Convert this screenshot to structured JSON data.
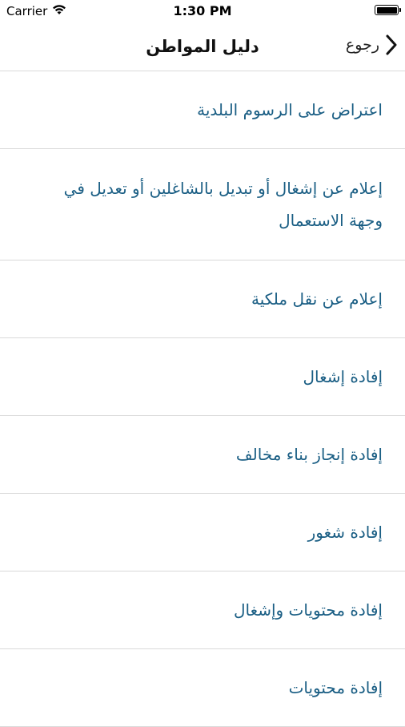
{
  "status": {
    "carrier": "Carrier",
    "time": "1:30 PM"
  },
  "nav": {
    "title": "دليل المواطن",
    "back_label": "رجوع"
  },
  "items": [
    {
      "label": "اعتراض على الرسوم البلدية"
    },
    {
      "label": "إعلام عن إشغال أو تبديل بالشاغلين أو تعديل في وجهة الاستعمال"
    },
    {
      "label": "إعلام عن نقل ملكية"
    },
    {
      "label": "إفادة إشغال"
    },
    {
      "label": "إفادة إنجاز بناء مخالف"
    },
    {
      "label": "إفادة شغور"
    },
    {
      "label": "إفادة محتويات وإشغال"
    },
    {
      "label": "إفادة محتويات"
    }
  ],
  "colors": {
    "item_text": "#1a5e84",
    "separator": "#d9d9d9"
  }
}
